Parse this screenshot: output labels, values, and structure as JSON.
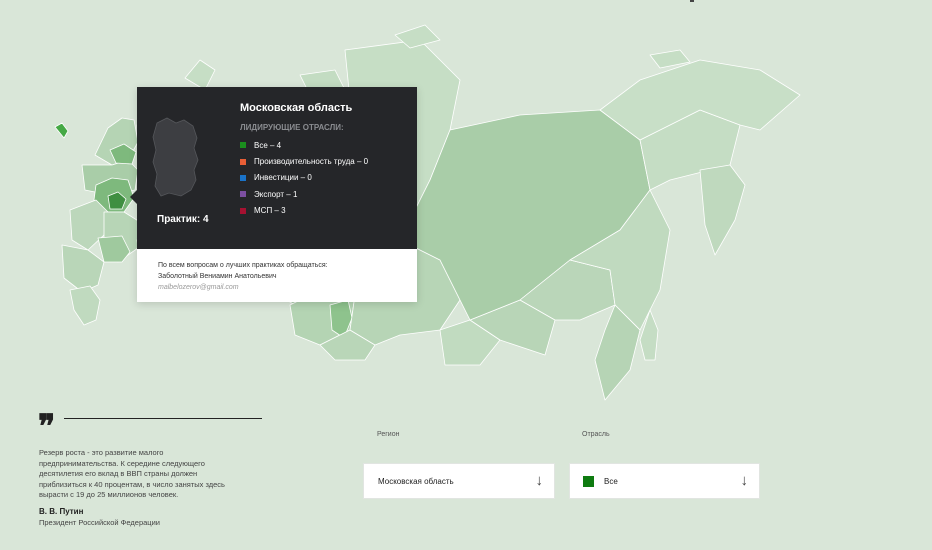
{
  "map": {
    "region_colors": {
      "base": "#bcd7bb",
      "light": "#c8dfc7",
      "mid": "#a9cda8",
      "strong": "#7eb97d",
      "bright": "#45a945",
      "dark": "#3f8f41",
      "far_east": "#c5ddc4"
    }
  },
  "tooltip": {
    "region_name": "Московская область",
    "industries_heading": "ЛИДИРУЮЩИЕ ОТРАСЛИ:",
    "industries": [
      {
        "label": "Все – 4",
        "color": "#1b8e1e"
      },
      {
        "label": "Производительность труда – 0",
        "color": "#e85e36"
      },
      {
        "label": "Инвестиции – 0",
        "color": "#1a73c9"
      },
      {
        "label": "Экспорт – 1",
        "color": "#7c4fa1"
      },
      {
        "label": "МСП – 3",
        "color": "#a51131"
      }
    ],
    "practices_count": "Практик: 4",
    "contact_intro": "По всем вопросам о лучших практиках обращаться:",
    "contact_name": "Заболотный Вениамин Анатольевич",
    "contact_email": "malbelozerov@gmail.com"
  },
  "quote": {
    "mark": "❞",
    "text": "Резерв роста - это развитие малого предпринимательства. К середине следующего десятилетия его вклад в ВВП страны должен приблизиться к 40 процентам, в число занятых здесь вырасти с 19 до 25 миллионов человек.",
    "author": "В. В. Путин",
    "role": "Президент Российской Федерации"
  },
  "filters": {
    "region": {
      "label": "Регион",
      "value": "Московская область",
      "icon": "arrow-down-icon",
      "arrow_glyph": "↓"
    },
    "industry": {
      "label": "Отрасль",
      "value": "Все",
      "swatch_color": "#0e7b10",
      "icon": "arrow-down-icon",
      "arrow_glyph": "↓"
    }
  }
}
